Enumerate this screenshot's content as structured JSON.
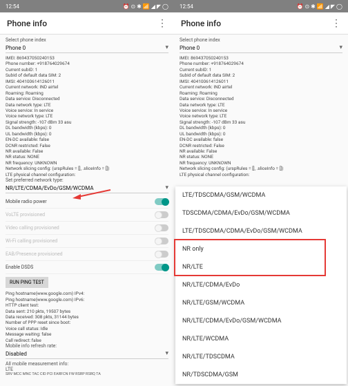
{
  "status": {
    "time": "12:54",
    "icons": "⏰ ⊙ ✱ 📶 ◢ ◤ ◯"
  },
  "title": "Phone info",
  "L": {
    "selectLabel": "Select phone index",
    "phone": "Phone 0",
    "info": [
      "IMEI: 869437050240153",
      "Phone number: +918764029674",
      "Current subID: 1",
      "SubId of default data SIM: 2",
      "IMSI: 404100614126011",
      "Current network: IND airtel",
      "Roaming: Roaming",
      "Data service: Disconnected",
      "Data network type: LTE",
      "Voice service: In service",
      "Voice network type: LTE",
      "Signal strength: -107 dBm   33 asu",
      "DL bandwidth (kbps): 0",
      "UL bandwidth (kbps): 0",
      "EN-DC available: false",
      "DCNR restricted: False",
      "NR available: False",
      "NR status: NONE",
      "NR frequency: UNKNOWN",
      "Network slicing config: (urspRules = [], .sliceInfo = [])",
      "LTE physical channel configuration:"
    ],
    "prefLabel": "Set preferred network type:",
    "pref": "NR/LTE/CDMA/EvDo/GSM/WCDMA",
    "toggles": [
      {
        "t": "Mobile radio power",
        "on": true,
        "dim": false
      },
      {
        "t": "VoLTE provisioned",
        "on": false,
        "dim": true
      },
      {
        "t": "Video calling provisioned",
        "on": false,
        "dim": true
      },
      {
        "t": "Wi-Fi calling provisioned",
        "on": false,
        "dim": true
      },
      {
        "t": "EAB/Presence provisioned",
        "on": false,
        "dim": true
      },
      {
        "t": "Enable DSDS",
        "on": true,
        "dim": false
      }
    ],
    "btn": "RUN PING TEST",
    "ping": [
      "Ping hostname(www.google.com) IPv4:",
      "Ping hostname(www.google.com) IPv6:",
      "HTTP client test:",
      "Data sent: 210 pkts, 19507 bytes",
      "Data received: 308 pkts, 31144 bytes",
      "Number of PPP reset since boot:",
      "Voice call status: Idle",
      "Message waiting: false",
      "Call redirect: false"
    ],
    "refreshLabel": "Mobile info refresh rate:",
    "refresh": "Disabled",
    "meas": "All mobile measurement info:",
    "lte": "LTE",
    "foot": "SRV MCC MNC TAC   CID   PCI EARFCN FW RSRP RSRQ TA"
  },
  "R": {
    "selectLabel": "Select phone index",
    "phone": "Phone 0",
    "info": [
      "IMEI: 869437050240153",
      "Phone number: +918764029674",
      "Current subID: 1",
      "SubId of default data SIM: 2",
      "IMSI: 404100614126011",
      "Current network: IND airtel",
      "Roaming: Roaming",
      "Data service: Disconnected",
      "Data network type: LTE",
      "Voice service: In service",
      "Voice network type: LTE",
      "Signal strength: -107 dBm   33 asu",
      "DL bandwidth (kbps): 0",
      "UL bandwidth (kbps): 0",
      "EN-DC available: false",
      "DCNR restricted: False",
      "NR available: False",
      "NR status: NONE",
      "NR frequency: UNKNOWN",
      "Network slicing config: (urspRules = [], .sliceInfo = [])",
      "LTE physical channel configuration:"
    ]
  },
  "dd": [
    "LTE/TDSCDMA/GSM/WCDMA",
    "TDSCDMA/CDMA/EvDo/GSM/WCDMA",
    "LTE/TDSCDMA/CDMA/EvDo/GSM/WCDMA",
    "NR only",
    "NR/LTE",
    "NR/LTE/CDMA/EvDo",
    "NR/LTE/GSM/WCDMA",
    "NR/LTE/CDMA/EvDo/GSM/WCDMA",
    "NR/LTE/WCDMA",
    "NR/LTE/TDSCDMA",
    "NR/TDSCDMA/GSM"
  ],
  "highlight": {
    "from": 3,
    "to": 4
  }
}
